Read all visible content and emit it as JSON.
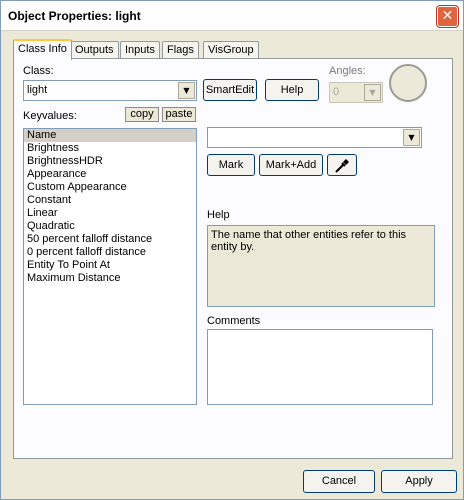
{
  "window": {
    "title": "Object Properties: light"
  },
  "tabs": [
    {
      "label": "Class Info",
      "active": true
    },
    {
      "label": "Outputs"
    },
    {
      "label": "Inputs"
    },
    {
      "label": "Flags"
    },
    {
      "label": "VisGroup"
    }
  ],
  "class_label": "Class:",
  "class_value": "light",
  "smartedit_label": "SmartEdit",
  "help_button_label": "Help",
  "angles_label": "Angles:",
  "angles_value": "0",
  "keyvalues_label": "Keyvalues:",
  "copy_label": "copy",
  "paste_label": "paste",
  "keyvalues": [
    "Name",
    "Brightness",
    "BrightnessHDR",
    "Appearance",
    "Custom Appearance",
    "Constant",
    "Linear",
    "Quadratic",
    "50 percent falloff distance",
    "0 percent falloff distance",
    "Entity To Point At",
    "Maximum Distance"
  ],
  "value_combo_value": "",
  "mark_label": "Mark",
  "mark_add_label": "Mark+Add",
  "help_section_label": "Help",
  "help_text": "The name that other entities refer to this entity by.",
  "comments_label": "Comments",
  "comments_value": "",
  "cancel_label": "Cancel",
  "apply_label": "Apply",
  "icons": {
    "close": "close-icon",
    "eyedropper": "eyedropper-icon",
    "dropdown": "chevron-down-icon"
  }
}
